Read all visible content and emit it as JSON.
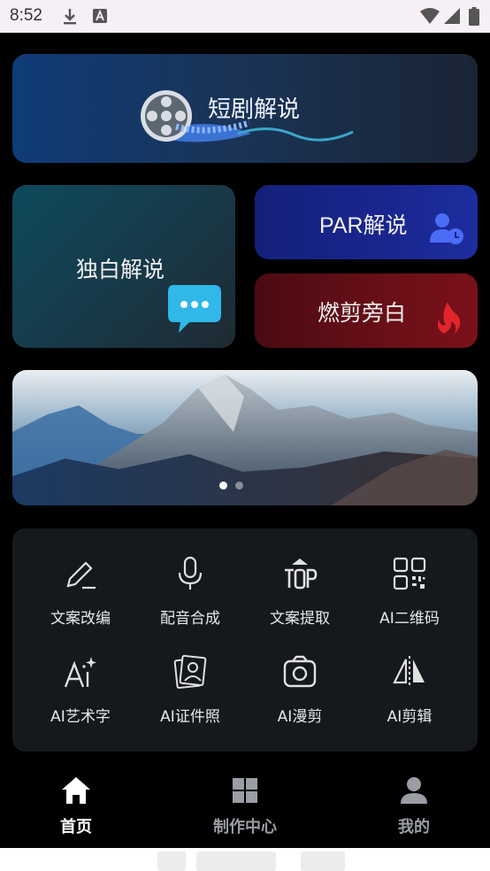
{
  "status_bar": {
    "time": "8:52"
  },
  "hero": {
    "title": "短剧解说"
  },
  "cards": {
    "dubai": {
      "title": "独白解说"
    },
    "par": {
      "title": "PAR解说"
    },
    "ran": {
      "title": "燃剪旁白"
    }
  },
  "banner": {
    "slides": 2,
    "active_index": 0
  },
  "tools": [
    {
      "label": "文案改编",
      "icon": "pencil-icon"
    },
    {
      "label": "配音合成",
      "icon": "microphone-icon"
    },
    {
      "label": "文案提取",
      "icon": "top-icon"
    },
    {
      "label": "AI二维码",
      "icon": "qr-code-icon"
    },
    {
      "label": "AI艺术字",
      "icon": "ai-sparkle-icon"
    },
    {
      "label": "AI证件照",
      "icon": "id-photo-icon"
    },
    {
      "label": "AI漫剪",
      "icon": "camera-icon"
    },
    {
      "label": "AI剪辑",
      "icon": "mirror-cut-icon"
    }
  ],
  "tabbar": {
    "items": [
      {
        "label": "首页",
        "icon": "home-icon",
        "active": true
      },
      {
        "label": "制作中心",
        "icon": "grid-icon",
        "active": false
      },
      {
        "label": "我的",
        "icon": "user-icon",
        "active": false
      }
    ]
  },
  "colors": {
    "background": "#000000",
    "panel": "#15181d",
    "active_dot": "#ffffff"
  }
}
